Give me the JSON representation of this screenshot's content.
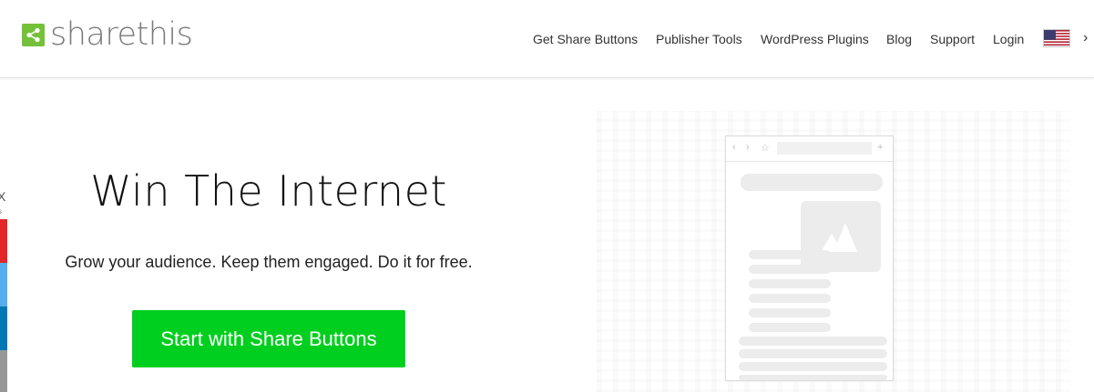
{
  "brand": {
    "name": "sharethis",
    "accent": "#75c13a"
  },
  "nav": {
    "items": [
      {
        "label": "Get Share Buttons"
      },
      {
        "label": "Publisher Tools"
      },
      {
        "label": "WordPress Plugins"
      },
      {
        "label": "Blog"
      },
      {
        "label": "Support"
      },
      {
        "label": "Login"
      }
    ],
    "language_icon": "us-flag-icon",
    "more_icon": "chevron-right-icon"
  },
  "sharebar": {
    "close_label": "X",
    "count_label": "s",
    "colors": [
      "#e32728",
      "#55acee",
      "#0077b5",
      "#95989a"
    ]
  },
  "hero": {
    "title": "Win The Internet",
    "subtitle": "Grow your audience. Keep them engaged. Do it for free.",
    "cta_label": "Start with Share Buttons",
    "cta_color": "#01cf1f"
  },
  "illustration": {
    "browser_icons": [
      "back-icon",
      "forward-icon",
      "star-icon",
      "plus-icon"
    ]
  }
}
